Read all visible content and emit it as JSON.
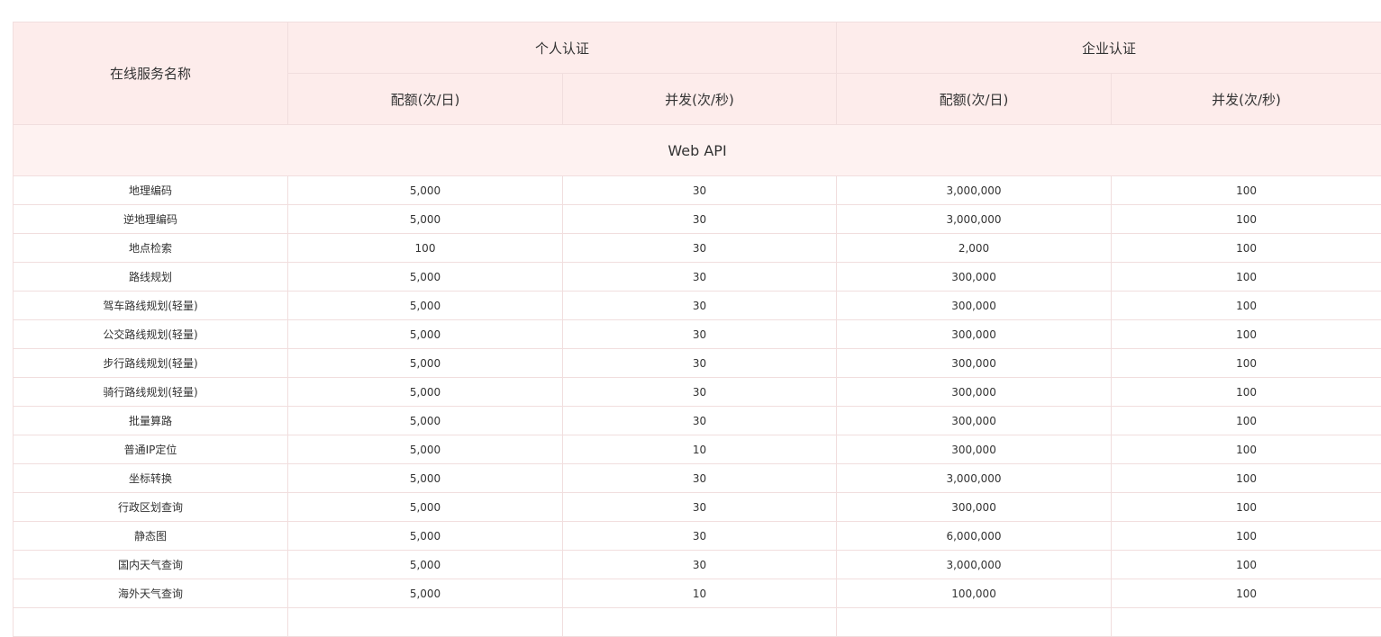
{
  "table": {
    "header": {
      "service_name": "在线服务名称",
      "personal": "个人认证",
      "enterprise": "企业认证",
      "quota": "配额(次/日)",
      "concurrency": "并发(次/秒)"
    },
    "section_title": "Web API",
    "rows": [
      {
        "name": "地理编码",
        "p_quota": "5,000",
        "p_conc": "30",
        "e_quota": "3,000,000",
        "e_conc": "100"
      },
      {
        "name": "逆地理编码",
        "p_quota": "5,000",
        "p_conc": "30",
        "e_quota": "3,000,000",
        "e_conc": "100"
      },
      {
        "name": "地点检索",
        "p_quota": "100",
        "p_conc": "30",
        "e_quota": "2,000",
        "e_conc": "100"
      },
      {
        "name": "路线规划",
        "p_quota": "5,000",
        "p_conc": "30",
        "e_quota": "300,000",
        "e_conc": "100"
      },
      {
        "name": "驾车路线规划(轻量)",
        "p_quota": "5,000",
        "p_conc": "30",
        "e_quota": "300,000",
        "e_conc": "100"
      },
      {
        "name": "公交路线规划(轻量)",
        "p_quota": "5,000",
        "p_conc": "30",
        "e_quota": "300,000",
        "e_conc": "100"
      },
      {
        "name": "步行路线规划(轻量)",
        "p_quota": "5,000",
        "p_conc": "30",
        "e_quota": "300,000",
        "e_conc": "100"
      },
      {
        "name": "骑行路线规划(轻量)",
        "p_quota": "5,000",
        "p_conc": "30",
        "e_quota": "300,000",
        "e_conc": "100"
      },
      {
        "name": "批量算路",
        "p_quota": "5,000",
        "p_conc": "30",
        "e_quota": "300,000",
        "e_conc": "100"
      },
      {
        "name": "普通IP定位",
        "p_quota": "5,000",
        "p_conc": "10",
        "e_quota": "300,000",
        "e_conc": "100"
      },
      {
        "name": "坐标转换",
        "p_quota": "5,000",
        "p_conc": "30",
        "e_quota": "3,000,000",
        "e_conc": "100"
      },
      {
        "name": "行政区划查询",
        "p_quota": "5,000",
        "p_conc": "30",
        "e_quota": "300,000",
        "e_conc": "100"
      },
      {
        "name": "静态图",
        "p_quota": "5,000",
        "p_conc": "30",
        "e_quota": "6,000,000",
        "e_conc": "100"
      },
      {
        "name": "国内天气查询",
        "p_quota": "5,000",
        "p_conc": "30",
        "e_quota": "3,000,000",
        "e_conc": "100"
      },
      {
        "name": "海外天气查询",
        "p_quota": "5,000",
        "p_conc": "10",
        "e_quota": "100,000",
        "e_conc": "100"
      }
    ]
  }
}
